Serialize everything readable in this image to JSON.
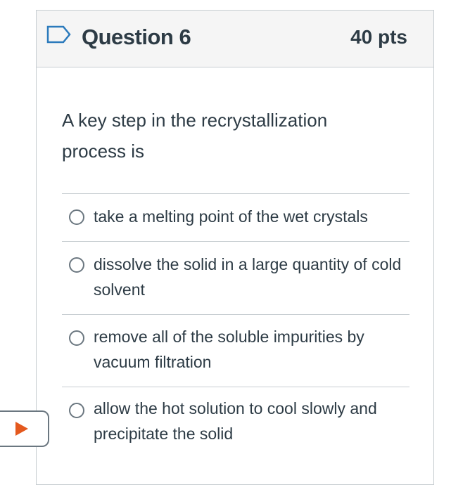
{
  "header": {
    "title": "Question 6",
    "points": "40 pts",
    "flag_icon": "flag-outline-icon",
    "flag_color": "#2b7abc"
  },
  "question": {
    "text": "A key step in the recrystallization process is"
  },
  "answers": [
    {
      "label": "take a melting point of the wet crystals",
      "selected": false
    },
    {
      "label": "dissolve the solid in a large quantity of cold solvent",
      "selected": false
    },
    {
      "label": "remove all of the soluble impurities by vacuum filtration",
      "selected": false
    },
    {
      "label": "allow the hot solution to cool slowly and precipitate the solid",
      "selected": false
    }
  ],
  "side_tab": {
    "icon": "play-triangle-icon",
    "icon_color": "#e4591e"
  },
  "colors": {
    "header_bg": "#f5f5f5",
    "border": "#c7cdd1",
    "text": "#2d3b45"
  }
}
